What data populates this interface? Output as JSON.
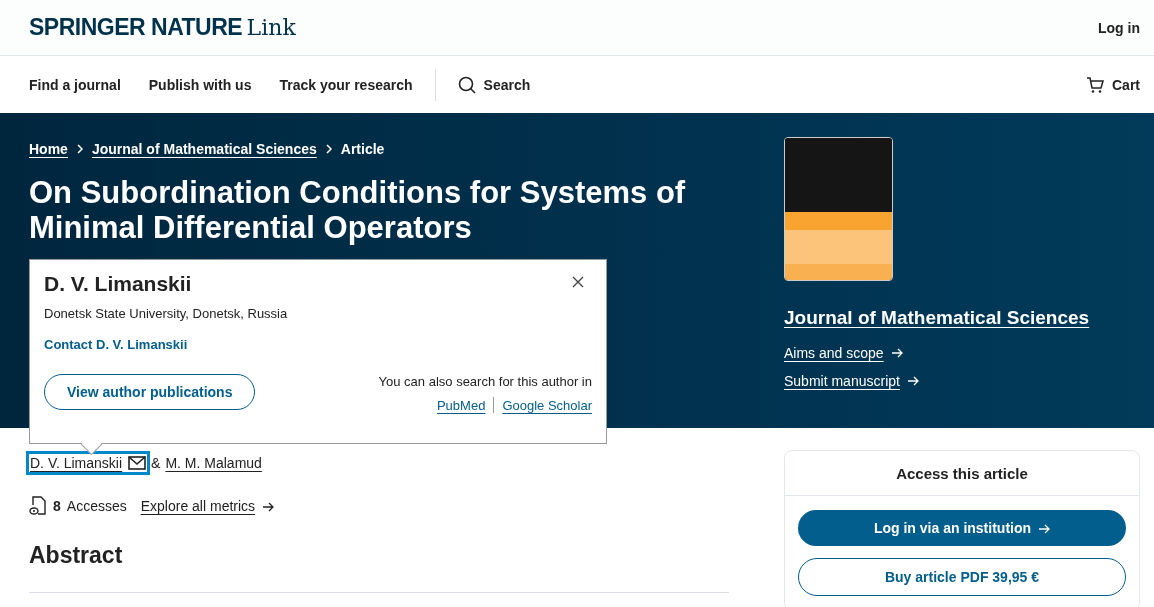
{
  "header": {
    "logo_bold": "SPRINGER NATURE",
    "logo_light": "Link",
    "login": "Log in"
  },
  "nav": {
    "items": [
      "Find a journal",
      "Publish with us",
      "Track your research"
    ],
    "search": "Search",
    "cart": "Cart"
  },
  "breadcrumb": [
    "Home",
    "Journal of Mathematical Sciences",
    "Article"
  ],
  "title": "On Subordination Conditions for Systems of Minimal Differential Operators",
  "journal": {
    "name": "Journal of Mathematical Sciences",
    "links": [
      "Aims and scope",
      "Submit manuscript"
    ]
  },
  "author_popup": {
    "name": "D. V. Limanskii",
    "affiliation": "Donetsk State University, Donetsk, Russia",
    "contact": "Contact D. V. Limanskii",
    "button": "View author publications",
    "search_note": "You can also search for this author in",
    "search_links": [
      "PubMed",
      "Google Scholar"
    ]
  },
  "authors": [
    {
      "name": "D. V. Limanskii",
      "selected": true,
      "email": true
    },
    {
      "name": "M. M. Malamud",
      "selected": false,
      "email": false
    }
  ],
  "authors_joiner": "&",
  "metrics": {
    "count": "8",
    "label": "Accesses",
    "link": "Explore all metrics"
  },
  "abstract_heading": "Abstract",
  "access": {
    "title": "Access this article",
    "primary": "Log in via an institution",
    "secondary": "Buy article PDF 39,95 €"
  }
}
